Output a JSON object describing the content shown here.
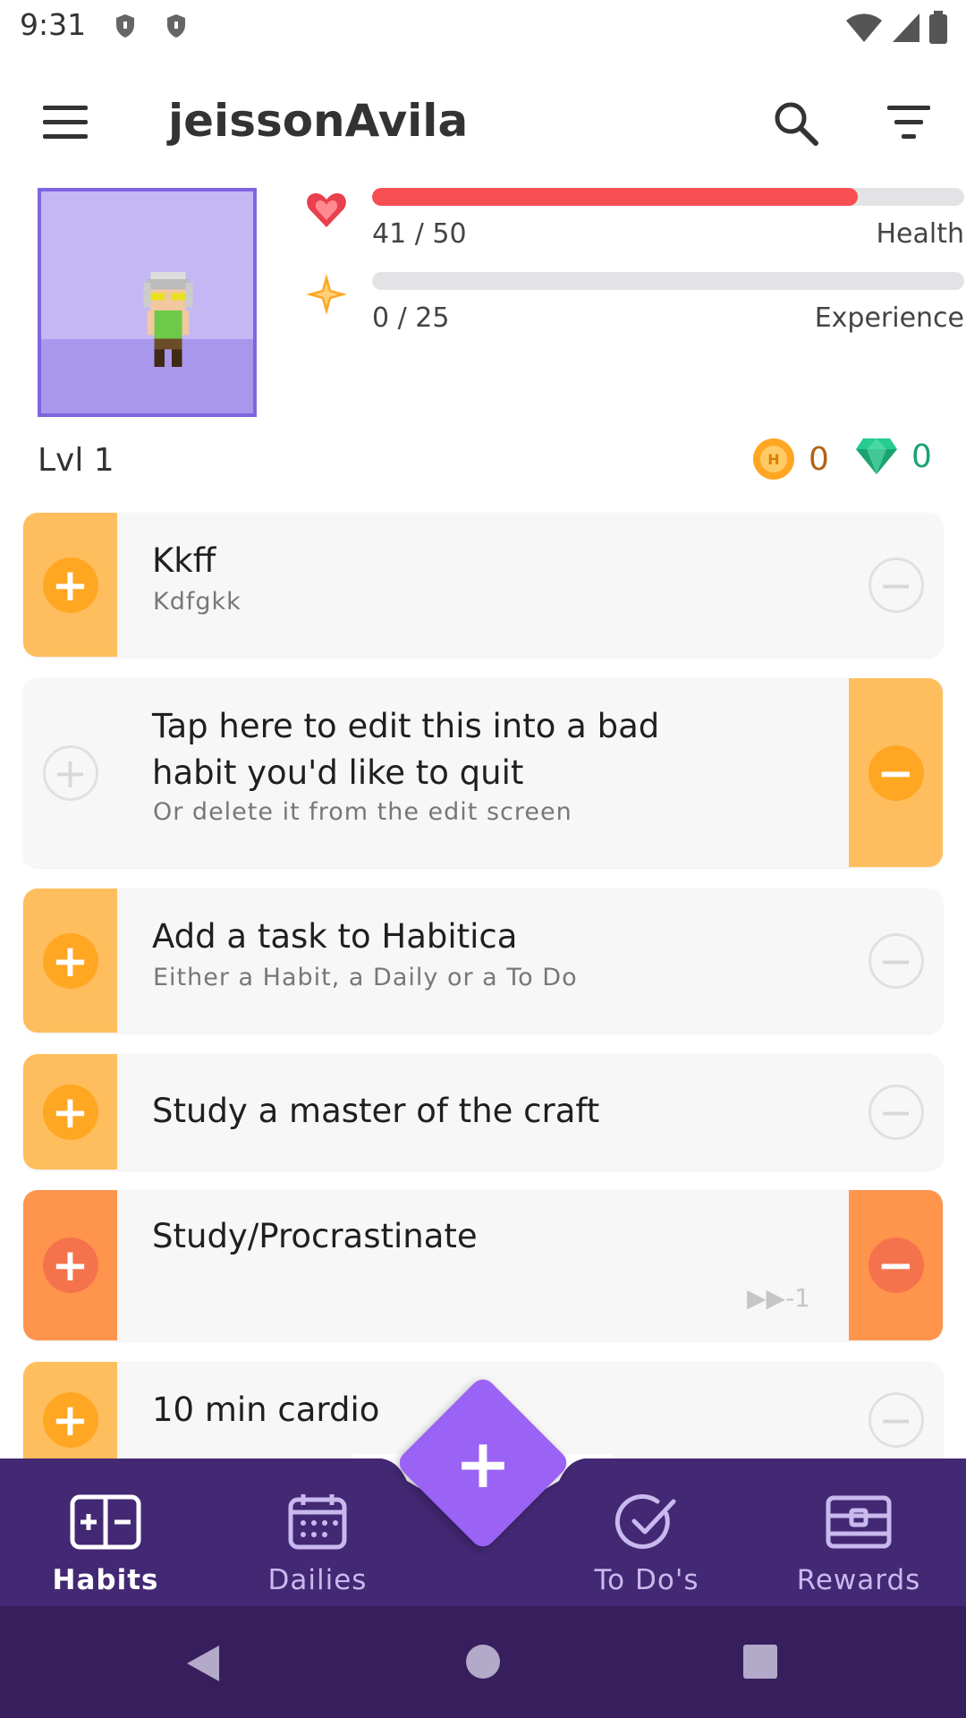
{
  "status_bar": {
    "time": "9:31"
  },
  "toolbar": {
    "title": "jeissonAvila"
  },
  "stats": {
    "health": {
      "value_text": "41 / 50",
      "label": "Health",
      "fraction": 0.82,
      "color": "#f74e52"
    },
    "experience": {
      "value_text": "0 / 25",
      "label": "Experience",
      "fraction": 0.0,
      "color": "#ffb445"
    }
  },
  "level": "Lvl 1",
  "currency": {
    "gold": "0",
    "gems": "0"
  },
  "tasks": [
    {
      "title": "Kkff",
      "subtitle": "Kdfgkk",
      "up": true,
      "down": false
    },
    {
      "title": "Tap here to edit this into a bad habit you'd like to quit",
      "subtitle": "Or delete it from the edit screen",
      "up": false,
      "down": true
    },
    {
      "title": "Add a task to Habitica",
      "subtitle": "Either a Habit, a Daily or a To Do",
      "up": true,
      "down": false
    },
    {
      "title": "Study a master of the craft",
      "subtitle": "",
      "up": true,
      "down": false
    },
    {
      "title": "Study/Procrastinate",
      "subtitle": "",
      "streak": "-1",
      "up": true,
      "down": true
    },
    {
      "title": "10 min cardio",
      "subtitle": "",
      "up": true,
      "down": false
    }
  ],
  "nav": {
    "habits": "Habits",
    "dailies": "Dailies",
    "todos": "To Do's",
    "rewards": "Rewards"
  },
  "colors": {
    "habit_yellow": "#ffbe5d",
    "habit_orange": "#ff944c",
    "button_yellow": "#ffa623",
    "button_orange": "#f4734c",
    "nav_bg": "#432874",
    "accent": "#9a62f5"
  }
}
